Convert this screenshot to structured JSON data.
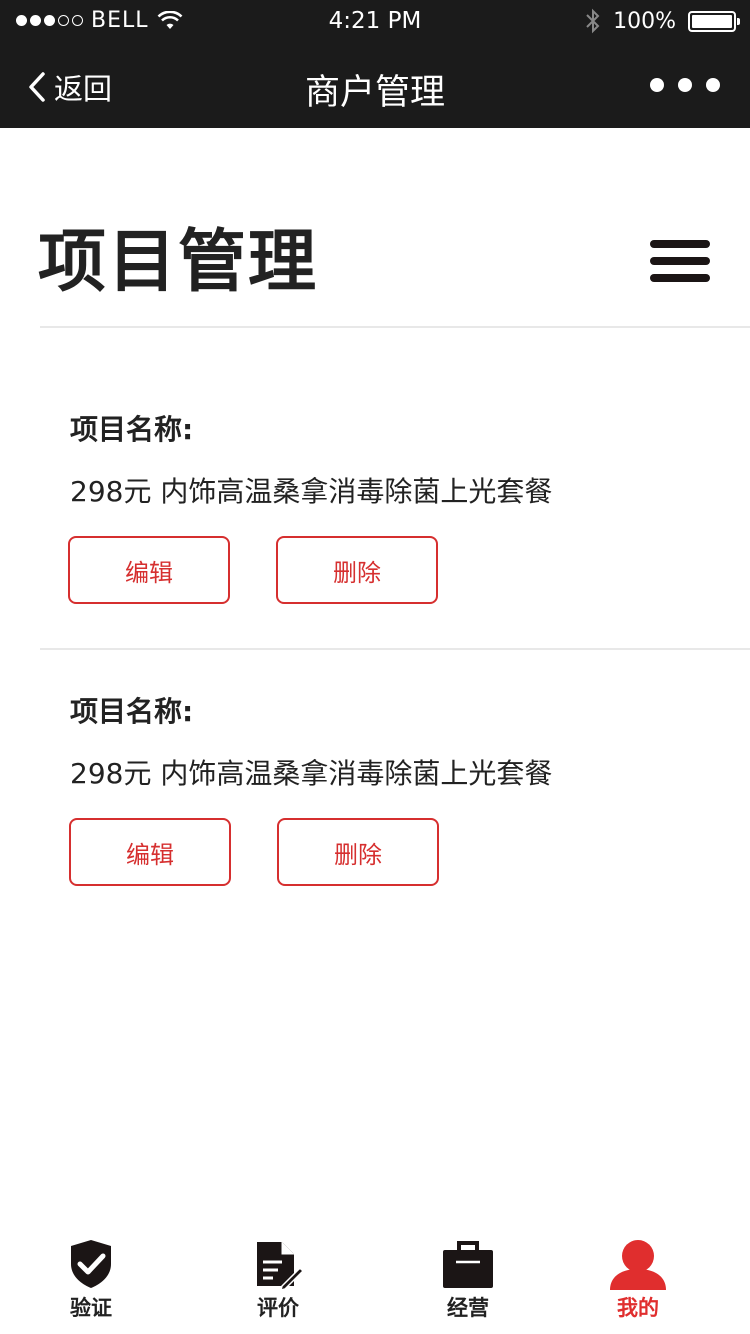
{
  "status_bar": {
    "carrier": "BELL",
    "time": "4:21 PM",
    "battery": "100%",
    "battery_level": 1.0,
    "signal_filled": 3,
    "signal_total": 5
  },
  "nav": {
    "back_label": "返回",
    "title": "商户管理"
  },
  "page": {
    "title": "项目管理"
  },
  "items": [
    {
      "label": "项目名称:",
      "name": "298元 内饰高温桑拿消毒除菌上光套餐",
      "edit_label": "编辑",
      "delete_label": "删除"
    },
    {
      "label": "项目名称:",
      "name": "298元 内饰高温桑拿消毒除菌上光套餐",
      "edit_label": "编辑",
      "delete_label": "删除"
    }
  ],
  "tabs": [
    {
      "label": "验证",
      "icon": "shield-check-icon",
      "active": false
    },
    {
      "label": "评价",
      "icon": "document-edit-icon",
      "active": false
    },
    {
      "label": "经营",
      "icon": "briefcase-icon",
      "active": false
    },
    {
      "label": "我的",
      "icon": "user-icon",
      "active": true
    }
  ],
  "colors": {
    "bar_bg": "#1b1b1b",
    "accent": "#d62f2f",
    "active_tab": "#e02e2e",
    "text": "#222222"
  }
}
